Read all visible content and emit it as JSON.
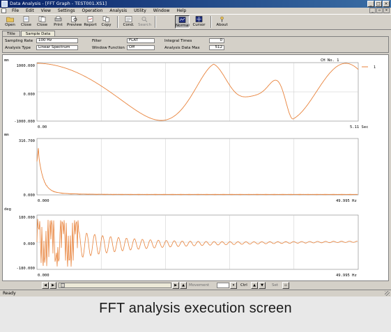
{
  "window": {
    "title": "Data Analysis - [FFT Graph - TEST001.XS1]"
  },
  "menu": [
    "File",
    "Edit",
    "View",
    "Settings",
    "Operation",
    "Analysis",
    "Utility",
    "Window",
    "Help"
  ],
  "toolbar": [
    {
      "label": "Open",
      "icon": "folder-open-icon",
      "enabled": true
    },
    {
      "label": "Close",
      "icon": "close-file-icon",
      "enabled": true
    },
    {
      "label": "Close",
      "icon": "close-all-icon",
      "enabled": true
    },
    {
      "label": "Print",
      "icon": "printer-icon",
      "enabled": true
    },
    {
      "label": "Preview",
      "icon": "preview-icon",
      "enabled": true
    },
    {
      "label": "Report",
      "icon": "report-icon",
      "enabled": true
    },
    {
      "label": "Copy",
      "icon": "copy-icon",
      "enabled": true
    },
    {
      "label": "Cond.",
      "icon": "condition-icon",
      "enabled": true
    },
    {
      "label": "Search",
      "icon": "search-icon",
      "enabled": false
    },
    {
      "label": "Normal",
      "icon": "normal-view-icon",
      "enabled": true,
      "pressed": true
    },
    {
      "label": "Cursor",
      "icon": "cursor-icon",
      "enabled": true
    },
    {
      "label": "About",
      "icon": "about-icon",
      "enabled": true
    }
  ],
  "tabs": [
    "Title",
    "Sample Data"
  ],
  "info": {
    "sampling_rate_label": "Sampling Rate",
    "sampling_rate": "100 Hz",
    "filter_label": "Filter",
    "filter": "FLAT",
    "integral_label": "Integral Times",
    "integral": "0",
    "analysis_type_label": "Analysis Type",
    "analysis_type": "Linear Spectrum",
    "window_function_label": "Window Function",
    "window_function": "Off",
    "analysis_max_label": "Analysis Data Max",
    "analysis_max": "512"
  },
  "graphs": {
    "channel": "CH No. 1",
    "series_color": "#e8823a",
    "time": {
      "unit": "mm",
      "ymax": "1000.000",
      "ymid": "0.000",
      "ymin": "-1000.000",
      "xmin": "0.00",
      "xmax": "5.11 Sec"
    },
    "amplitude": {
      "unit": "mm",
      "ymax": "316.700",
      "ymin": "0.000",
      "xmin": "0.000",
      "xmax": "49.995 Hz"
    },
    "phase": {
      "unit": "deg",
      "ymax": "180.000",
      "ymid": "0.000",
      "ymin": "-180.000",
      "xmin": "0.000",
      "xmax": "49.995 Hz"
    }
  },
  "bottom": {
    "movement_label": "Movement",
    "ctrl_label": "Ctrl",
    "set_label": "Set"
  },
  "status": "Ready",
  "caption": "FFT analysis execution screen"
}
